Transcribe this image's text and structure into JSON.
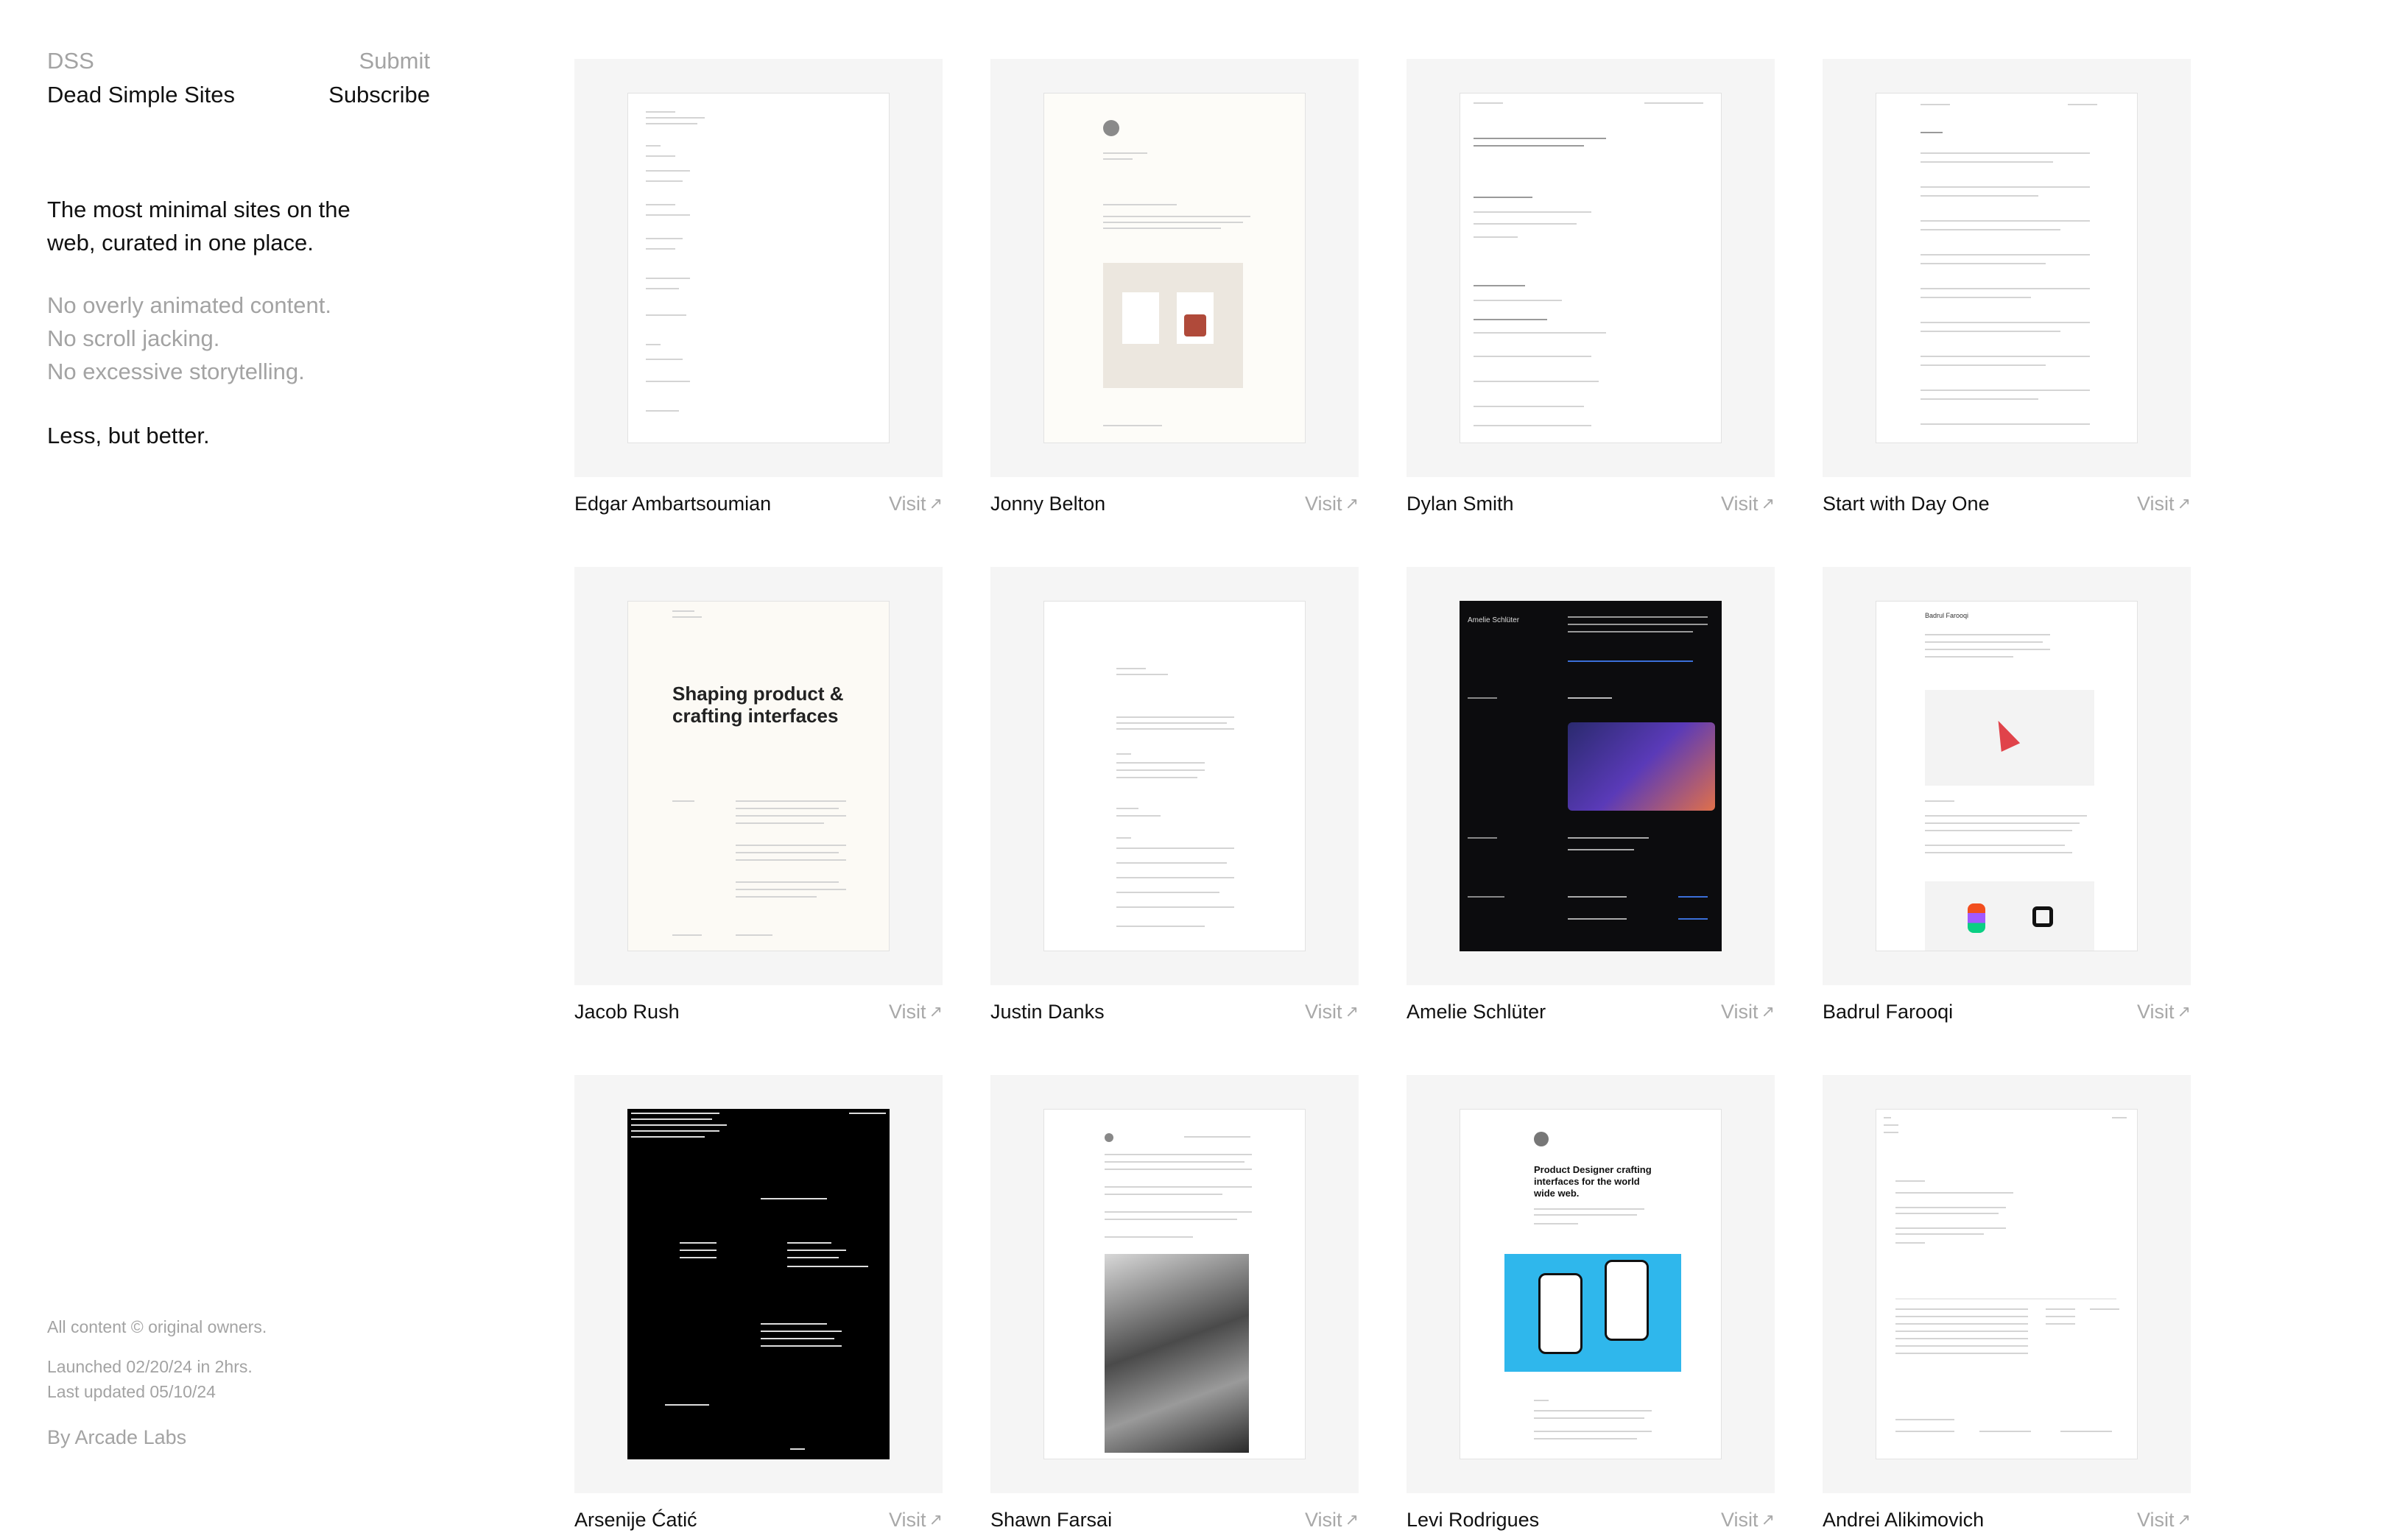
{
  "brand": {
    "short": "DSS",
    "name": "Dead Simple Sites",
    "submit_label": "Submit",
    "subscribe_label": "Subscribe"
  },
  "intro": {
    "tagline": "The most minimal sites on the web, curated in one place.",
    "negatives": [
      "No overly animated content.",
      "No scroll jacking.",
      "No excessive storytelling."
    ],
    "motto": "Less, but better."
  },
  "footer": {
    "rights": "All content © original owners.",
    "launched": "Launched 02/20/24 in 2hrs.",
    "updated": "Last updated 05/10/24",
    "by": "By Arcade Labs"
  },
  "visit_label": "Visit",
  "sites": [
    {
      "name": "Edgar Ambartsoumian"
    },
    {
      "name": "Jonny Belton"
    },
    {
      "name": "Dylan Smith"
    },
    {
      "name": "Start with Day One"
    },
    {
      "name": "Jacob Rush",
      "headline": "Shaping product & crafting interfaces"
    },
    {
      "name": "Justin Danks"
    },
    {
      "name": "Amelie Schlüter",
      "preview_title": "Amelie Schlüter"
    },
    {
      "name": "Badrul Farooqi",
      "preview_title": "Badrul Farooqi"
    },
    {
      "name": "Arsenije Ćatić"
    },
    {
      "name": "Shawn Farsai"
    },
    {
      "name": "Levi Rodrigues",
      "headline": "Product Designer crafting interfaces for the world wide web."
    },
    {
      "name": "Andrei Alikimovich"
    }
  ],
  "colors": {
    "text": "#111111",
    "muted": "#a3a3a3",
    "card_bg": "#f5f5f5",
    "accent_blue": "#2aa8e0"
  }
}
